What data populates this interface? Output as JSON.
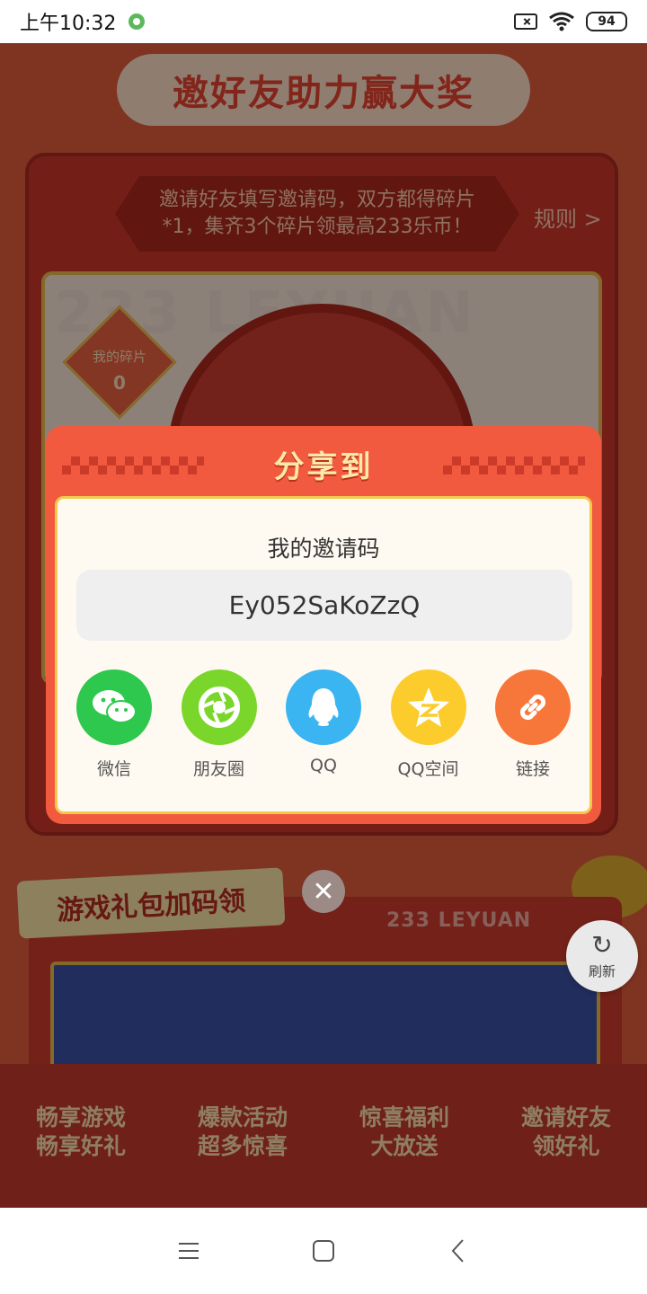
{
  "status_bar": {
    "time": "上午10:32",
    "battery": "94"
  },
  "background": {
    "banner_title": "邀好友助力赢大奖",
    "tip_line1": "邀请好友填写邀请码，双方都得碎片",
    "tip_line2": "*1，集齐3个碎片领最高233乐币！",
    "rules": "规则 >",
    "panel_big_text": "233 LEYUAN",
    "fragment_label": "我的碎片",
    "fragment_count": "0",
    "gift_tag": "游戏礼包加码领",
    "leyuan_text": "233 LEYUAN",
    "features": [
      {
        "line1": "畅享游戏",
        "line2": "畅享好礼"
      },
      {
        "line1": "爆款活动",
        "line2": "超多惊喜"
      },
      {
        "line1": "惊喜福利",
        "line2": "大放送"
      },
      {
        "line1": "邀请好友",
        "line2": "领好礼"
      }
    ]
  },
  "refresh": {
    "label": "刷新"
  },
  "modal": {
    "title": "分享到",
    "code_label": "我的邀请码",
    "invite_code": "Ey052SaKoZzQ",
    "share_options": [
      {
        "label": "微信",
        "icon": "wechat-icon",
        "color": "#2dc84d"
      },
      {
        "label": "朋友圈",
        "icon": "moments-icon",
        "color": "#7ad62a"
      },
      {
        "label": "QQ",
        "icon": "qq-icon",
        "color": "#3bb4f2"
      },
      {
        "label": "QQ空间",
        "icon": "qzone-icon",
        "color": "#fccc2c"
      },
      {
        "label": "链接",
        "icon": "link-icon",
        "color": "#f7773b"
      }
    ]
  }
}
